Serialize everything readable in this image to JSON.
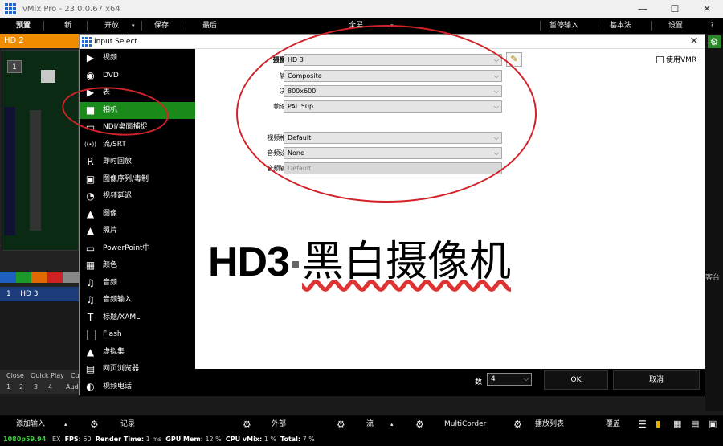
{
  "window": {
    "title": "vMix Pro - 23.0.0.67 x64",
    "controls": [
      "—",
      "☐",
      "✕"
    ]
  },
  "menubar": {
    "items": [
      "预置",
      "新",
      "开放",
      "保存",
      "最后",
      "全屏",
      "暂停输入",
      "基本法",
      "设置",
      "?"
    ]
  },
  "preview": {
    "title": "HD 2",
    "badge": "1"
  },
  "input_list": {
    "row_index": "1",
    "row_label": "HD 3"
  },
  "bottom_tabs": {
    "tab1": "Close",
    "tab2": "Quick Play",
    "tab3": "Cu",
    "nums": [
      "1",
      "2",
      "3",
      "4"
    ],
    "audio": "Audi"
  },
  "side": {
    "label": "客台"
  },
  "bottombar": {
    "add_input": "添加输入",
    "record": "记录",
    "external": "外部",
    "stream": "流",
    "multicorder": "MultiCorder",
    "playlist": "播放列表",
    "overlay": "覆盖"
  },
  "statusbar": {
    "resolution": "1080p59.94",
    "ex": "EX",
    "fps_label": "FPS:",
    "fps": "60",
    "render_label": "Render Time:",
    "render": "1 ms",
    "gpu_label": "GPU Mem:",
    "gpu": "12 %",
    "cpu_label": "CPU vMix:",
    "cpu": "1 %",
    "total_label": "Total:",
    "total": "7 %"
  },
  "dialog": {
    "title": "Input Select",
    "categories": [
      {
        "label": "视频",
        "icon": "▶"
      },
      {
        "label": "DVD",
        "icon": "◉"
      },
      {
        "label": "表",
        "icon": "▶"
      },
      {
        "label": "相机",
        "icon": "■"
      },
      {
        "label": "NDI/桌面捕捉",
        "icon": "▭"
      },
      {
        "label": "流/SRT",
        "icon": "((•))"
      },
      {
        "label": "即时回放",
        "icon": "R"
      },
      {
        "label": "图像序列/毒制",
        "icon": "▣"
      },
      {
        "label": "视频延迟",
        "icon": "◔"
      },
      {
        "label": "图像",
        "icon": "▲"
      },
      {
        "label": "照片",
        "icon": "▲"
      },
      {
        "label": "PowerPoint中",
        "icon": "▭"
      },
      {
        "label": "颜色",
        "icon": "▦"
      },
      {
        "label": "音频",
        "icon": "♫"
      },
      {
        "label": "音频输入",
        "icon": "♫"
      },
      {
        "label": "标题/XAML",
        "icon": "T"
      },
      {
        "label": "Flash",
        "icon": "❘❘"
      },
      {
        "label": "虚拟集",
        "icon": "▲"
      },
      {
        "label": "网页浏览器",
        "icon": "▤"
      },
      {
        "label": "视频电话",
        "icon": "◐"
      }
    ],
    "selected_index": 3,
    "fields": {
      "camera_label": "摄像头:",
      "camera_value": "HD 3",
      "input_label": "输入:",
      "input_value": "Composite",
      "resolution_label": "决议:",
      "resolution_value": "800x600",
      "framerate_label": "帧速率:",
      "framerate_value": "PAL 50p",
      "videoformat_label": "视频格式:",
      "videoformat_value": "Default",
      "audiodevice_label": "音频设备:",
      "audiodevice_value": "None",
      "audioinput_label": "音频输入:",
      "audioinput_value": "Default"
    },
    "vmr_label": "使用VMR",
    "overlay_text_en": "HD3",
    "overlay_text_cn": "黑白摄像机",
    "footer": {
      "number_label": "数",
      "number_value": "4",
      "ok": "OK",
      "cancel": "取消"
    }
  },
  "colors": {
    "selected": "#1a8a1a",
    "preview_header": "#f08c00",
    "annotation": "#d2222a",
    "input_row": "#1d3c7c"
  }
}
